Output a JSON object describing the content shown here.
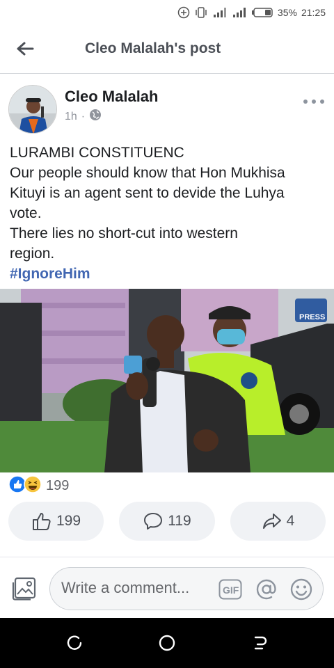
{
  "status_bar": {
    "battery": "35%",
    "time": "21:25",
    "icons": [
      "add-circle-icon",
      "vibrate-icon",
      "signal-icon",
      "signal-icon",
      "battery-icon"
    ]
  },
  "header": {
    "back_icon": "arrow-left-icon",
    "title": "Cleo Malalah's post"
  },
  "post": {
    "author": "Cleo Malalah",
    "time": "1h",
    "separator": "·",
    "privacy_icon": "globe-icon",
    "lines": [
      "LURAMBI CONSTITUENC",
      "Our people should know that Hon Mukhisa",
      "Kituyi is an agent sent to devide the Luhya",
      "vote.",
      "There lies no short-cut into western",
      "region."
    ],
    "hashtag": "#IgnoreHim",
    "image_watermark": "PRESS"
  },
  "reactions": {
    "icons": [
      "like-reaction-icon",
      "haha-reaction-icon"
    ],
    "count": "199"
  },
  "actions": {
    "like_count": "199",
    "comment_count": "119",
    "share_count": "4"
  },
  "comment": {
    "placeholder": "Write a comment...",
    "gif_label": "GIF"
  },
  "colors": {
    "accent": "#4267b2",
    "button_bg": "#f0f2f5",
    "text": "#1c1e21",
    "muted": "#65676b"
  }
}
